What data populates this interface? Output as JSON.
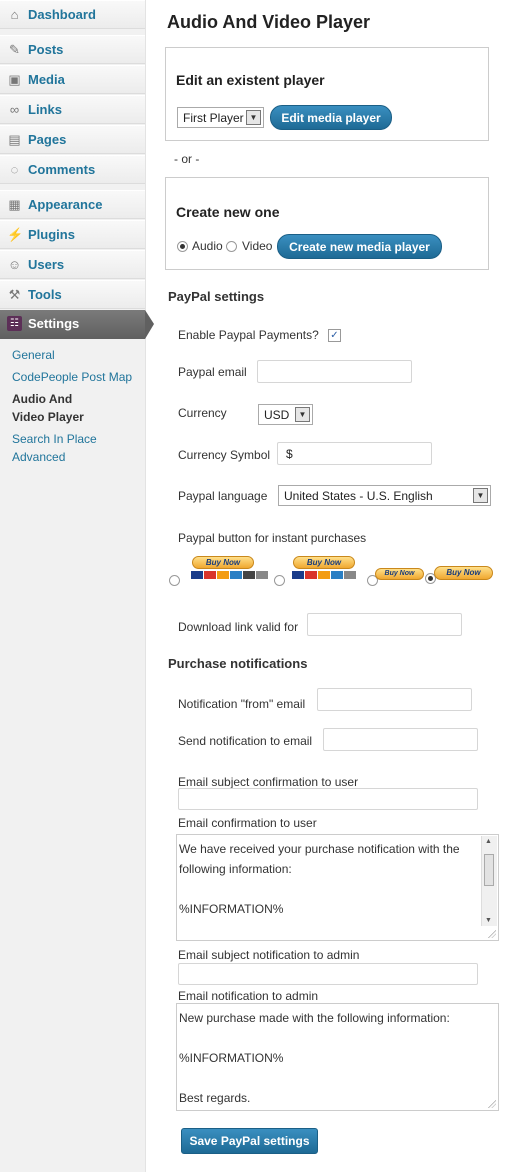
{
  "sidebar": {
    "menu": [
      {
        "label": "Dashboard",
        "icon": "dashboard-icon",
        "glyph": "⌂"
      },
      {
        "label": "Posts",
        "icon": "pushpin-icon",
        "glyph": "✎"
      },
      {
        "label": "Media",
        "icon": "media-icon",
        "glyph": "▣"
      },
      {
        "label": "Links",
        "icon": "links-icon",
        "glyph": "∞"
      },
      {
        "label": "Pages",
        "icon": "pages-icon",
        "glyph": "▤"
      },
      {
        "label": "Comments",
        "icon": "comments-icon",
        "glyph": "◌"
      },
      {
        "label": "Appearance",
        "icon": "appearance-icon",
        "glyph": "▦"
      },
      {
        "label": "Plugins",
        "icon": "plugins-icon",
        "glyph": "⚡"
      },
      {
        "label": "Users",
        "icon": "users-icon",
        "glyph": "☺"
      },
      {
        "label": "Tools",
        "icon": "tools-icon",
        "glyph": "⚒"
      },
      {
        "label": "Settings",
        "icon": "settings-icon",
        "glyph": "☷"
      }
    ],
    "submenu": [
      "General",
      "CodePeople Post Map",
      "Audio And",
      "Video Player",
      "Search In Place",
      "Advanced"
    ]
  },
  "page": {
    "title": "Audio And Video Player",
    "edit_panel": {
      "title": "Edit an existent player",
      "selected_player": "First Player",
      "edit_button": "Edit media player"
    },
    "or_text": "- or -",
    "create_panel": {
      "title": "Create new one",
      "audio_label": "Audio",
      "video_label": "Video",
      "selected_type": "Audio",
      "create_button": "Create new media player"
    },
    "paypal": {
      "heading": "PayPal settings",
      "enable_label": "Enable Paypal Payments?",
      "enable_checked": true,
      "email_label": "Paypal email",
      "email_value": "",
      "currency_label": "Currency",
      "currency_value": "USD",
      "symbol_label": "Currency Symbol",
      "symbol_value": "$",
      "language_label": "Paypal language",
      "language_value": "United States - U.S. English",
      "button_label": "Paypal button for instant purchases",
      "buy_now_text": "Buy Now",
      "selected_button_index": 3,
      "download_label": "Download link valid for",
      "download_value": ""
    },
    "notifications": {
      "heading": "Purchase notifications",
      "from_label": "Notification \"from\" email",
      "from_value": "",
      "to_label": "Send notification to email",
      "to_value": "",
      "user_subject_label": "Email subject confirmation to user",
      "user_subject_value": "",
      "user_email_label": "Email confirmation to user",
      "user_email_value": "We have received your purchase notification with the following information:\n\n%INFORMATION%",
      "admin_subject_label": "Email subject notification to admin",
      "admin_subject_value": "",
      "admin_email_label": "Email notification to admin",
      "admin_email_value": "New purchase made with the following information:\n\n%INFORMATION%\n\nBest regards."
    },
    "save_button": "Save PayPal settings"
  },
  "colors": {
    "link": "#21759b",
    "button": "#21759b",
    "active_menu": "#6a6a6a"
  }
}
